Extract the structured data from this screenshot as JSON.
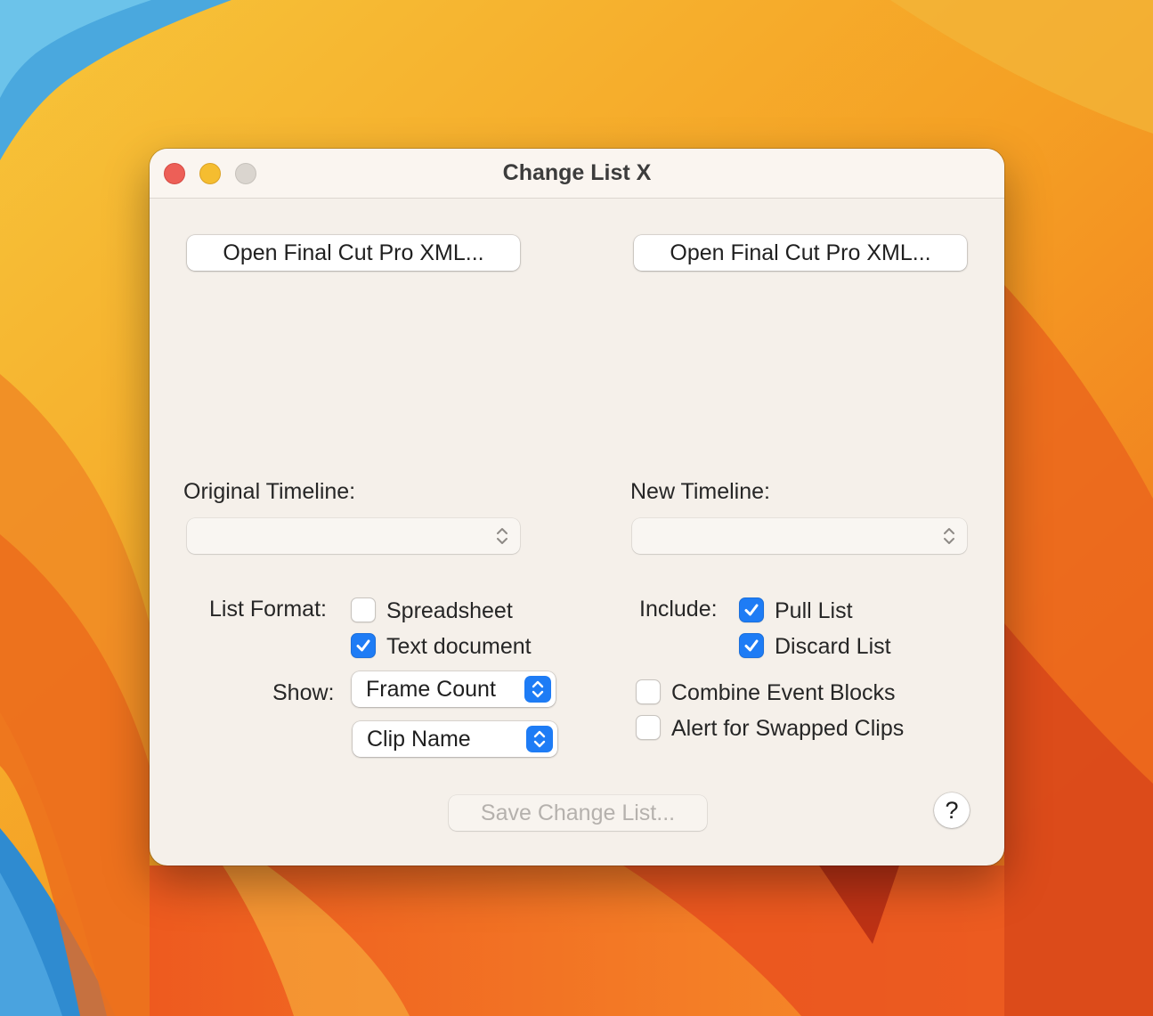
{
  "window": {
    "title": "Change List X"
  },
  "left_panel": {
    "open_button_label": "Open Final Cut Pro XML...",
    "timeline_label": "Original Timeline:",
    "timeline_selection": ""
  },
  "right_panel": {
    "open_button_label": "Open Final Cut Pro XML...",
    "timeline_label": "New Timeline:",
    "timeline_selection": ""
  },
  "list_format": {
    "label": "List Format:",
    "options": [
      {
        "label": "Spreadsheet",
        "checked": false
      },
      {
        "label": "Text document",
        "checked": true
      }
    ]
  },
  "show": {
    "label": "Show:",
    "primary_value": "Frame Count",
    "secondary_value": "Clip Name"
  },
  "include": {
    "label": "Include:",
    "options": [
      {
        "label": "Pull List",
        "checked": true
      },
      {
        "label": "Discard List",
        "checked": true
      }
    ]
  },
  "extra_options": [
    {
      "label": "Combine Event Blocks",
      "checked": false
    },
    {
      "label": "Alert for Swapped Clips",
      "checked": false
    }
  ],
  "footer": {
    "save_label": "Save Change List...",
    "save_enabled": false,
    "help_label": "?"
  },
  "colors": {
    "accent": "#1e7cf5",
    "window_bg": "#f5f0ea",
    "close": "#ed5f57",
    "minimize": "#f5bd30"
  }
}
